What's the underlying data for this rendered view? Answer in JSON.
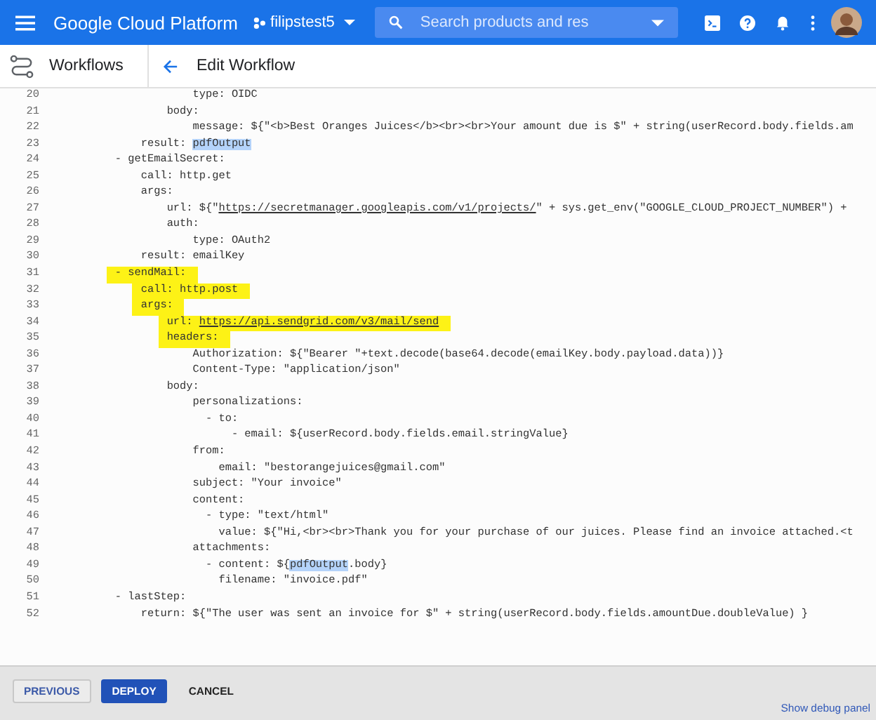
{
  "topbar": {
    "title": "Google Cloud Platform",
    "project": "filipstest5",
    "search": {
      "placeholder": "Search products and res"
    }
  },
  "subbar": {
    "section": "Workflows",
    "title": "Edit Workflow"
  },
  "editor": {
    "lines": [
      {
        "number": "20",
        "marker": false,
        "segments": [
          {
            "kind": "plain",
            "text": "                    type: OIDC"
          }
        ]
      },
      {
        "number": "21",
        "marker": false,
        "segments": [
          {
            "kind": "plain",
            "text": "                body:"
          }
        ]
      },
      {
        "number": "22",
        "marker": false,
        "segments": [
          {
            "kind": "plain",
            "text": "                    message: ${\"<b>Best Oranges Juices</b><br><br>Your amount due is $\" + string(userRecord.body.fields.am"
          }
        ]
      },
      {
        "number": "23",
        "marker": false,
        "segments": [
          {
            "kind": "plain",
            "text": "            result: "
          },
          {
            "kind": "selection",
            "text": "pdfOutput"
          }
        ]
      },
      {
        "number": "24",
        "marker": false,
        "segments": [
          {
            "kind": "plain",
            "text": "        - getEmailSecret:"
          }
        ]
      },
      {
        "number": "25",
        "marker": false,
        "segments": [
          {
            "kind": "plain",
            "text": "            call: http.get"
          }
        ]
      },
      {
        "number": "26",
        "marker": false,
        "segments": [
          {
            "kind": "plain",
            "text": "            args:"
          }
        ]
      },
      {
        "number": "27",
        "marker": false,
        "segments": [
          {
            "kind": "plain",
            "text": "                url: ${\""
          },
          {
            "kind": "link",
            "text": "https://secretmanager.googleapis.com/v1/projects/"
          },
          {
            "kind": "plain",
            "text": "\" + sys.get_env(\"GOOGLE_CLOUD_PROJECT_NUMBER\") +"
          }
        ]
      },
      {
        "number": "28",
        "marker": false,
        "segments": [
          {
            "kind": "plain",
            "text": "                auth:"
          }
        ]
      },
      {
        "number": "29",
        "marker": false,
        "segments": [
          {
            "kind": "plain",
            "text": "                    type: OAuth2"
          }
        ]
      },
      {
        "number": "30",
        "marker": false,
        "segments": [
          {
            "kind": "plain",
            "text": "            result: emailKey"
          }
        ]
      },
      {
        "number": "31",
        "marker": true,
        "segments": [
          {
            "kind": "plain",
            "text": "        - sendMail:"
          }
        ]
      },
      {
        "number": "32",
        "marker": true,
        "segments": [
          {
            "kind": "plain",
            "text": "            call: http.post"
          }
        ]
      },
      {
        "number": "33",
        "marker": true,
        "segments": [
          {
            "kind": "plain",
            "text": "            args:"
          }
        ]
      },
      {
        "number": "34",
        "marker": true,
        "segments": [
          {
            "kind": "plain",
            "text": "                url: "
          },
          {
            "kind": "link",
            "text": "https://api.sendgrid.com/v3/mail/send"
          }
        ]
      },
      {
        "number": "35",
        "marker": true,
        "segments": [
          {
            "kind": "plain",
            "text": "                headers:"
          }
        ]
      },
      {
        "number": "36",
        "marker": false,
        "segments": [
          {
            "kind": "plain",
            "text": "                    Authorization: ${\"Bearer \"+text.decode(base64.decode(emailKey.body.payload.data))}"
          }
        ]
      },
      {
        "number": "37",
        "marker": false,
        "segments": [
          {
            "kind": "plain",
            "text": "                    Content-Type: \"application/json\""
          }
        ]
      },
      {
        "number": "38",
        "marker": false,
        "segments": [
          {
            "kind": "plain",
            "text": "                body:"
          }
        ]
      },
      {
        "number": "39",
        "marker": false,
        "segments": [
          {
            "kind": "plain",
            "text": "                    personalizations:"
          }
        ]
      },
      {
        "number": "40",
        "marker": false,
        "segments": [
          {
            "kind": "plain",
            "text": "                      - to:"
          }
        ]
      },
      {
        "number": "41",
        "marker": false,
        "segments": [
          {
            "kind": "plain",
            "text": "                          - email: ${userRecord.body.fields.email.stringValue}"
          }
        ]
      },
      {
        "number": "42",
        "marker": false,
        "segments": [
          {
            "kind": "plain",
            "text": "                    from:"
          }
        ]
      },
      {
        "number": "43",
        "marker": false,
        "segments": [
          {
            "kind": "plain",
            "text": "                        email: \"bestorangejuices@gmail.com\""
          }
        ]
      },
      {
        "number": "44",
        "marker": false,
        "segments": [
          {
            "kind": "plain",
            "text": "                    subject: \"Your invoice\""
          }
        ]
      },
      {
        "number": "45",
        "marker": false,
        "segments": [
          {
            "kind": "plain",
            "text": "                    content:"
          }
        ]
      },
      {
        "number": "46",
        "marker": false,
        "segments": [
          {
            "kind": "plain",
            "text": "                      - type: \"text/html\""
          }
        ]
      },
      {
        "number": "47",
        "marker": false,
        "segments": [
          {
            "kind": "plain",
            "text": "                        value: ${\"Hi,<br><br>Thank you for your purchase of our juices. Please find an invoice attached.<t"
          }
        ]
      },
      {
        "number": "48",
        "marker": false,
        "segments": [
          {
            "kind": "plain",
            "text": "                    attachments:"
          }
        ]
      },
      {
        "number": "49",
        "marker": false,
        "segments": [
          {
            "kind": "plain",
            "text": "                      - content: ${"
          },
          {
            "kind": "selection",
            "text": "pdfOutput"
          },
          {
            "kind": "plain",
            "text": ".body}"
          }
        ]
      },
      {
        "number": "50",
        "marker": false,
        "segments": [
          {
            "kind": "plain",
            "text": "                        filename: \"invoice.pdf\""
          }
        ]
      },
      {
        "number": "51",
        "marker": false,
        "segments": [
          {
            "kind": "plain",
            "text": "        - lastStep:"
          }
        ]
      },
      {
        "number": "52",
        "marker": false,
        "segments": [
          {
            "kind": "plain",
            "text": "            return: ${\"The user was sent an invoice for $\" + string(userRecord.body.fields.amountDue.doubleValue) }"
          }
        ]
      }
    ]
  },
  "footer": {
    "buttons": [
      {
        "label": "PREVIOUS",
        "kind": "outlined"
      },
      {
        "label": "DEPLOY",
        "kind": "primary"
      },
      {
        "label": "CANCEL",
        "kind": "text"
      }
    ],
    "debug_link": "Show debug panel"
  }
}
